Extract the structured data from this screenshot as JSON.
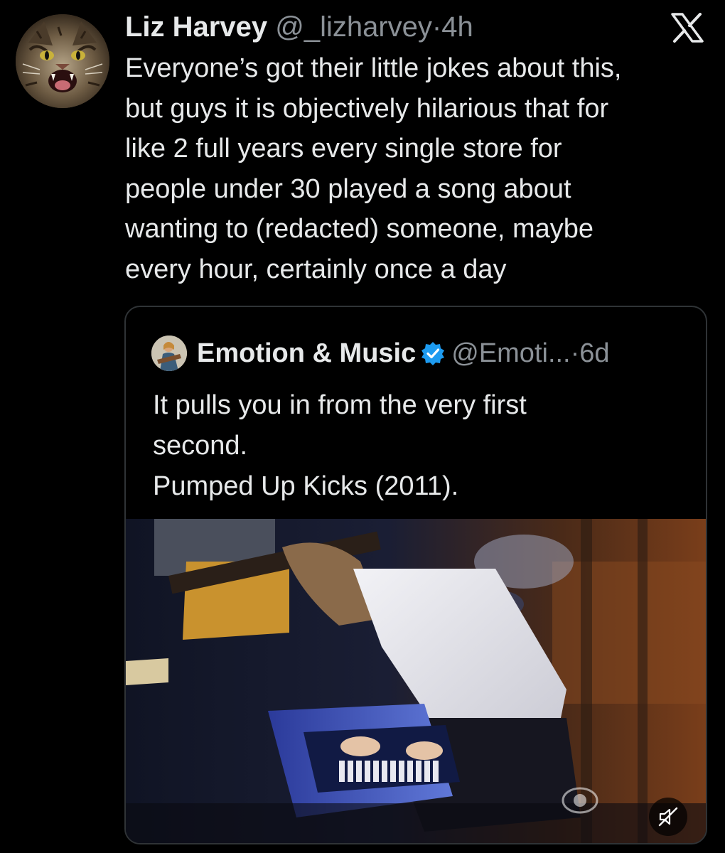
{
  "tweet": {
    "author_name": "Liz Harvey",
    "author_handle": "@_lizharvey",
    "separator": "·",
    "time": "4h",
    "avatar_icon": "cat-avatar-icon",
    "platform_icon": "x-logo-icon",
    "text": "Everyone’s got their little jokes about this,\nbut guys it is objectively hilarious that for\nlike 2 full years every single store for\npeople under 30 played a song about\nwanting to (redacted) someone, maybe\nevery hour, certainly once a day"
  },
  "quoted_tweet": {
    "author_name": "Emotion & Music",
    "verified_icon": "verified-badge-icon",
    "author_handle": "@Emoti...",
    "separator": "·",
    "time": "6d",
    "text": "It pulls you in from the very first\nsecond.\nPumped Up Kicks (2011).",
    "media": {
      "type": "video",
      "mute_icon": "muted-speaker-icon",
      "watermark_icon": "cbs-eye-icon"
    }
  },
  "colors": {
    "background": "#000000",
    "text_primary": "#e7e9ea",
    "text_secondary": "#8b9197",
    "border": "#2f3336",
    "verified_blue": "#1d9bf0"
  }
}
